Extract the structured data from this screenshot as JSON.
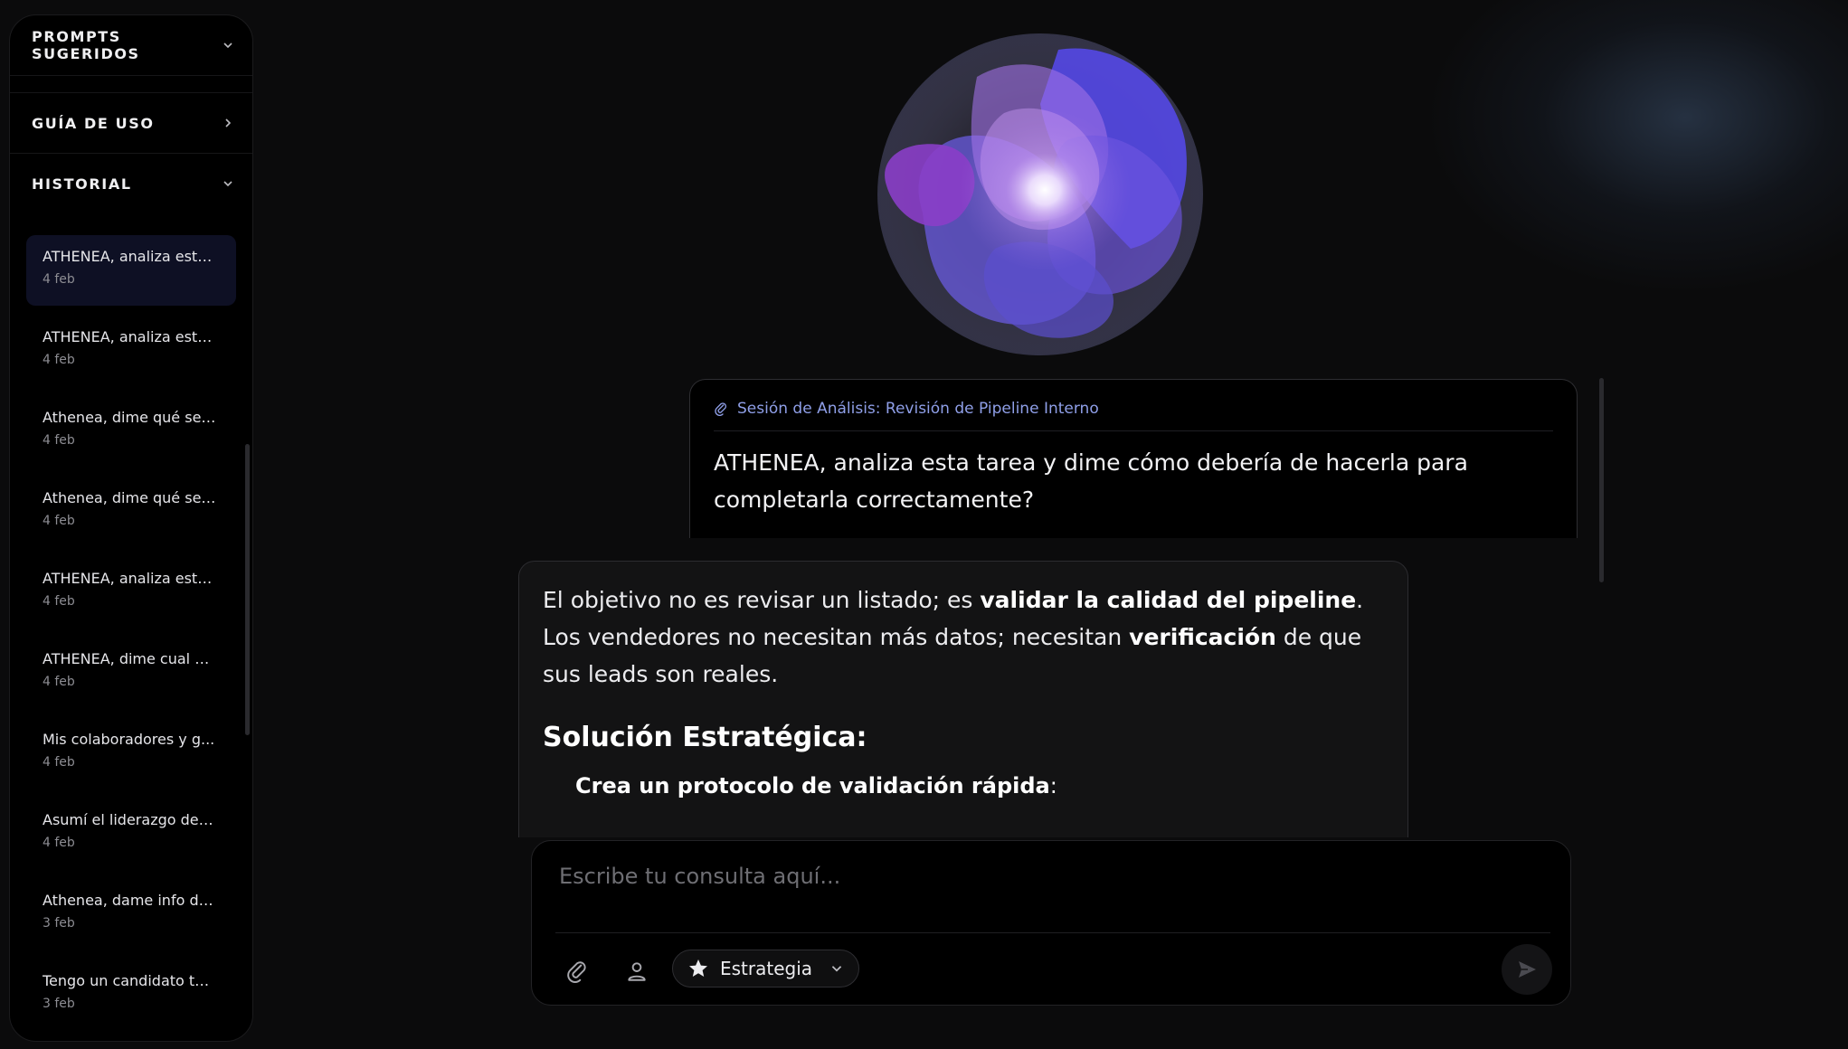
{
  "sidebar": {
    "sections": {
      "prompts": "PROMPTS SUGERIDOS",
      "guide": "GUÍA DE USO",
      "history": "HISTORIAL"
    },
    "history": [
      {
        "title": "ATHENEA, analiza esta...",
        "date": "4 feb",
        "active": true
      },
      {
        "title": "ATHENEA, analiza esta...",
        "date": "4 feb"
      },
      {
        "title": "Athenea, dime qué se ...",
        "date": "4 feb"
      },
      {
        "title": "Athenea, dime qué se ...",
        "date": "4 feb"
      },
      {
        "title": "ATHENEA, analiza esta...",
        "date": "4 feb"
      },
      {
        "title": "ATHENEA, dime cual e...",
        "date": "4 feb"
      },
      {
        "title": "Mis colaboradores y g...",
        "date": "4 feb"
      },
      {
        "title": "Asumí el liderazgo de ...",
        "date": "4 feb"
      },
      {
        "title": "Athenea, dame info de...",
        "date": "3 feb"
      },
      {
        "title": "Tengo un candidato té...",
        "date": "3 feb"
      }
    ]
  },
  "chat": {
    "user": {
      "session_label": "Sesión de Análisis: Revisión de Pipeline Interno",
      "text": "ATHENEA, analiza esta tarea y dime cómo debería de hacerla para completarla correctamente?"
    },
    "assistant": {
      "p1_a": "El objetivo no es revisar un listado; es ",
      "p1_b": "validar la calidad del pipeline",
      "p1_c": ". Los vendedores no necesitan más datos; necesitan ",
      "p1_d": "verificación",
      "p1_e": " de que sus leads son reales.",
      "heading": "Solución Estratégica:",
      "list_item": "Crea un protocolo de validación rápida",
      "list_item_suffix": ":"
    }
  },
  "composer": {
    "placeholder": "Escribe tu consulta aquí...",
    "mode_label": "Estrategia"
  },
  "icons": {
    "attach": "paperclip-icon",
    "persona": "user-icon",
    "mode": "star-icon",
    "send": "send-icon"
  },
  "colors": {
    "accent": "#8f9fe8",
    "active_item_bg": "#0e1024",
    "orb_primary": "#5a55e6",
    "orb_secondary": "#a35fe0"
  }
}
